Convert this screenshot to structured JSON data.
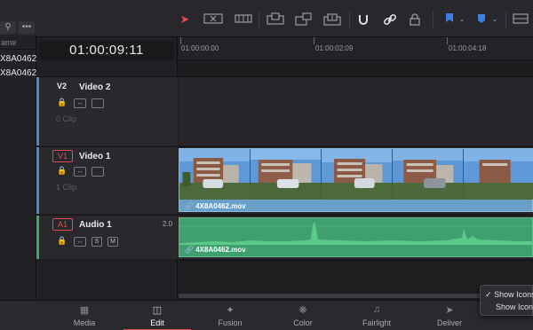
{
  "media_pool": {
    "column_header": "ame",
    "rows": [
      "X8A0462",
      "X8A0462"
    ],
    "icons": [
      "search-icon",
      "more-icon"
    ],
    "more_label": "•••"
  },
  "toolbar": {
    "tools": [
      "select-arrow-icon",
      "trim-edit-icon",
      "blade-edit-icon",
      "insert-clip-icon",
      "overwrite-clip-icon",
      "replace-clip-icon",
      "snapping-icon",
      "linked-selection-icon",
      "position-lock-icon",
      "flag-icon",
      "marker-icon",
      "timeline-view-icon"
    ],
    "accent_color": "#e24b4b",
    "flag_color": "#3d7fe0"
  },
  "timeline": {
    "current_timecode": "01:00:09:11",
    "ruler_labels": [
      "01:00:00:00",
      "01:00:02:09",
      "01:00:04:18"
    ]
  },
  "tracks": {
    "video2": {
      "badge": "V2",
      "name": "Video 2",
      "clips": "0 Clip"
    },
    "video1": {
      "badge": "V1",
      "name": "Video 1",
      "clips": "1 Clip",
      "clip_name": "4X8A0462.mov",
      "clip_color": "#6aa0c8"
    },
    "audio1": {
      "badge": "A1",
      "name": "Audio 1",
      "level": "2.0",
      "clip_name": "4X8A0462.mov",
      "clip_color": "#3f9f6e",
      "solo": "S",
      "mute": "M"
    }
  },
  "pages": [
    {
      "label": "Media",
      "icon": "media-page-icon"
    },
    {
      "label": "Edit",
      "icon": "edit-page-icon",
      "active": true
    },
    {
      "label": "Fusion",
      "icon": "fusion-page-icon"
    },
    {
      "label": "Color",
      "icon": "color-page-icon"
    },
    {
      "label": "Fairlight",
      "icon": "fairlight-page-icon"
    },
    {
      "label": "Deliver",
      "icon": "deliver-page-icon"
    }
  ],
  "popup": {
    "item1": "Show Icons",
    "item1_checked": "✓",
    "item2": "Show Icons"
  }
}
